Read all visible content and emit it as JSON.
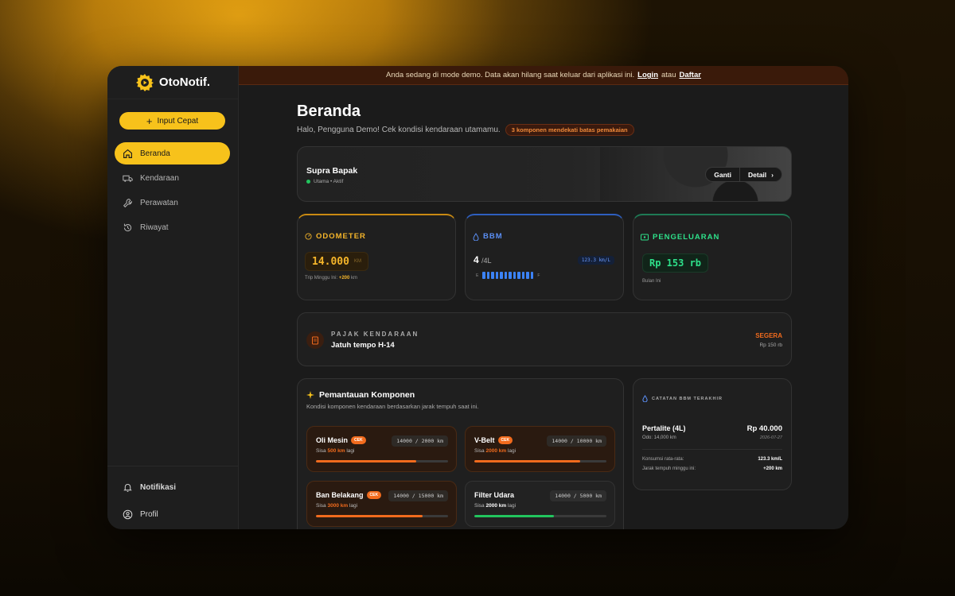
{
  "app": {
    "name": "OtoNotif."
  },
  "sidebar": {
    "quick_input": "Input Cepat",
    "items": [
      {
        "label": "Beranda",
        "icon": "home-icon",
        "active": true
      },
      {
        "label": "Kendaraan",
        "icon": "truck-icon"
      },
      {
        "label": "Perawatan",
        "icon": "wrench-icon"
      },
      {
        "label": "Riwayat",
        "icon": "history-icon"
      }
    ],
    "bottom": [
      {
        "label": "Notifikasi",
        "icon": "bell-icon"
      },
      {
        "label": "Profil",
        "icon": "user-icon"
      }
    ]
  },
  "banner": {
    "text": "Anda sedang di mode demo. Data akan hilang saat keluar dari aplikasi ini.",
    "login": "Login",
    "or": "atau",
    "register": "Daftar"
  },
  "page": {
    "title": "Beranda",
    "subtitle": "Halo, Pengguna Demo! Cek kondisi kendaraan utamamu.",
    "alert": "3 komponen mendekati batas pemakaian"
  },
  "vehicle": {
    "name": "Supra Bapak",
    "status": "Utama • Aktif",
    "switch": "Ganti",
    "detail": "Detail"
  },
  "odometer": {
    "label": "ODOMETER",
    "value": "14.000",
    "unit": "KM",
    "trip_label": "Trip Minggu Ini:",
    "trip_value": "+200",
    "trip_unit": "km"
  },
  "bbm": {
    "label": "BBM",
    "value": "4",
    "unit": "/4L",
    "efficiency": "123.3 km/L",
    "empty": "E",
    "full": "F",
    "level": 1.0
  },
  "expense": {
    "label": "PENGELUARAN",
    "value": "Rp 153 rb",
    "period": "Bulan Ini"
  },
  "tax": {
    "label": "PAJAK KENDARAAN",
    "due": "Jatuh tempo H-14",
    "status": "SEGERA",
    "amount": "Rp 150 rb"
  },
  "components": {
    "title": "Pemantauan Komponen",
    "desc": "Kondisi komponen kendaraan berdasarkan jarak tempuh saat ini.",
    "items": [
      {
        "name": "Oli Mesin",
        "tag": "CEK",
        "km": "14000 / 2000 km",
        "rem_prefix": "Sisa",
        "rem_value": "500 km",
        "rem_suffix": "lagi",
        "progress": 0.76,
        "warn": true
      },
      {
        "name": "V-Belt",
        "tag": "CEK",
        "km": "14000 / 10000 km",
        "rem_prefix": "Sisa",
        "rem_value": "2000 km",
        "rem_suffix": "lagi",
        "progress": 0.8,
        "warn": true
      },
      {
        "name": "Ban Belakang",
        "tag": "CEK",
        "km": "14000 / 15000 km",
        "rem_prefix": "Sisa",
        "rem_value": "3000 km",
        "rem_suffix": "lagi",
        "progress": 0.81,
        "warn": true
      },
      {
        "name": "Filter Udara",
        "tag": "",
        "km": "14000 / 5000 km",
        "rem_prefix": "Sisa",
        "rem_value": "2000 km",
        "rem_suffix": "lagi",
        "progress": 0.6,
        "warn": false
      }
    ]
  },
  "fuel_log": {
    "label": "CATATAN BBM TERAKHIR",
    "name": "Pertalite (4L)",
    "odo": "Odo: 14,000 km",
    "price": "Rp 40.000",
    "date": "2026-07-27",
    "avg_label": "Konsumsi rata-rata:",
    "avg_value": "123.3 km/L",
    "dist_label": "Jarak tempuh minggu ini:",
    "dist_value": "+200 km"
  },
  "colors": {
    "accent": "#f7c21b",
    "warning": "#f26b1d",
    "ok": "#22c55e",
    "fuel": "#3b82f6",
    "money": "#2ee08a"
  }
}
